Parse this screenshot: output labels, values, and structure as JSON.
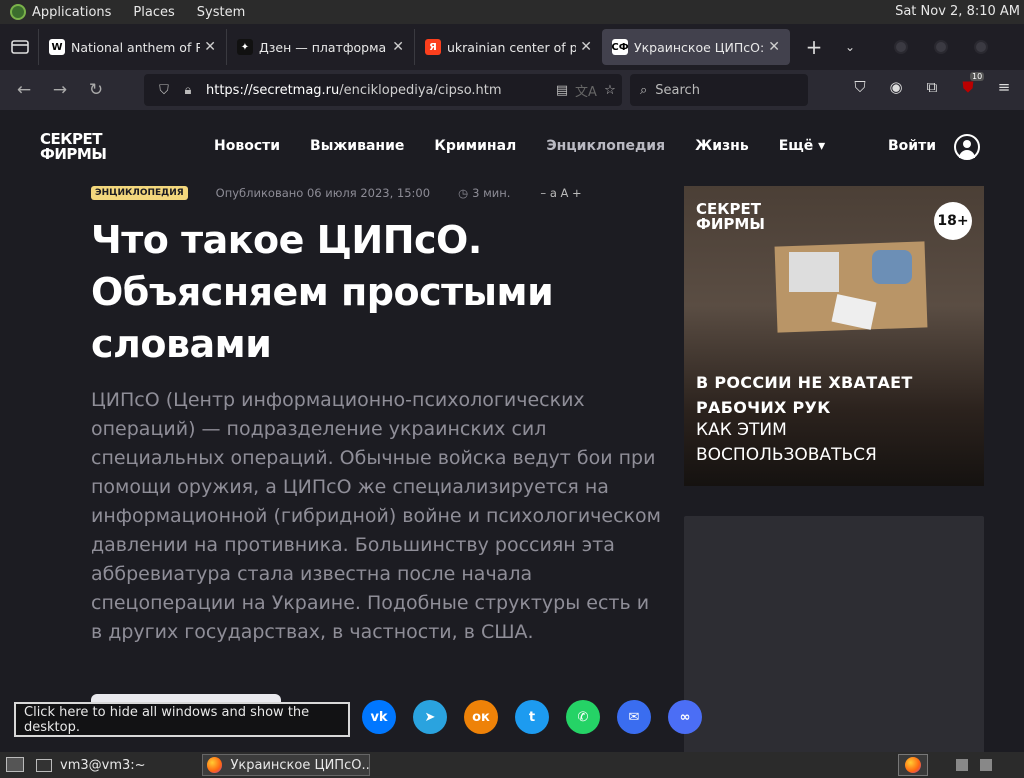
{
  "desktop": {
    "menus": [
      "Applications",
      "Places",
      "System"
    ],
    "clock": "Sat Nov  2,  8:10 AM"
  },
  "browser": {
    "tabs": [
      {
        "title": "National anthem of Ru",
        "favicon": "W",
        "fav_bg": "#ffffff",
        "fav_fg": "#000000"
      },
      {
        "title": "Дзен — платформа д",
        "favicon": "✦",
        "fav_bg": "#111111",
        "fav_fg": "#ffffff"
      },
      {
        "title": "ukrainian center of psy",
        "favicon": "Я",
        "fav_bg": "#fc3f1d",
        "fav_fg": "#ffffff"
      },
      {
        "title": "Украинское ЦИПсО: ч",
        "favicon": "СФ",
        "fav_bg": "#ffffff",
        "fav_fg": "#000000",
        "active": true
      }
    ],
    "url_host": "https://secretmag.ru",
    "url_path": "/enciklopediya/cipso.htm",
    "search_placeholder": "Search",
    "extension_badge": "10"
  },
  "site": {
    "brand_line1": "СЕКРЕТ",
    "brand_line2": "ФИРМЫ",
    "nav": [
      "Новости",
      "Выживание",
      "Криминал",
      "Энциклопедия",
      "Жизнь",
      "Ещё ▾"
    ],
    "login": "Войти"
  },
  "article": {
    "badge": "ЭНЦИКЛОПЕДИЯ",
    "published": "Опубликовано 06 июля 2023, 15:00",
    "read_time": "3 мин.",
    "font_size_control": "– a  A +",
    "headline": "Что такое ЦИПсО. Объясняем простыми словами",
    "lead": "ЦИПсО (Центр информационно-психологических операций) — подразделение украинских сил специальных операций. Обычные войска ведут бои при помощи оружия, а ЦИПсО же специализируется на информационной (гибридной) войне и психологическом давлении на противника. Большинству россиян эта аббревиатура стала известна после начала спецоперации на Украине. Подобные структуры есть и в других государствах, в частности, в США."
  },
  "ad": {
    "logo_line1": "СЕКРЕТ",
    "logo_line2": "ФИРМЫ",
    "age": "18+",
    "bold_line1": "В РОССИИ НЕ ХВАТАЕТ",
    "bold_line2": "РАБОЧИХ РУК",
    "line3": "КАК ЭТИМ",
    "line4": "ВОСПОЛЬЗОВАТЬСЯ"
  },
  "share": [
    {
      "name": "vk",
      "glyph": "vk",
      "color": "#0077ff"
    },
    {
      "name": "telegram",
      "glyph": "➤",
      "color": "#2aa3df"
    },
    {
      "name": "odnoklassniki",
      "glyph": "ок",
      "color": "#ee8208"
    },
    {
      "name": "twitter",
      "glyph": "t",
      "color": "#1d9bf0"
    },
    {
      "name": "whatsapp",
      "glyph": "✆",
      "color": "#25d366"
    },
    {
      "name": "email",
      "glyph": "✉",
      "color": "#3a6df0"
    },
    {
      "name": "copy-link",
      "glyph": "∞",
      "color": "#4b6ef5"
    }
  ],
  "tooltip": "Click here to hide all windows and show the desktop.",
  "taskbar": {
    "terminal": "vm3@vm3:~",
    "browser_window": "Украинское ЦИПсО..."
  }
}
